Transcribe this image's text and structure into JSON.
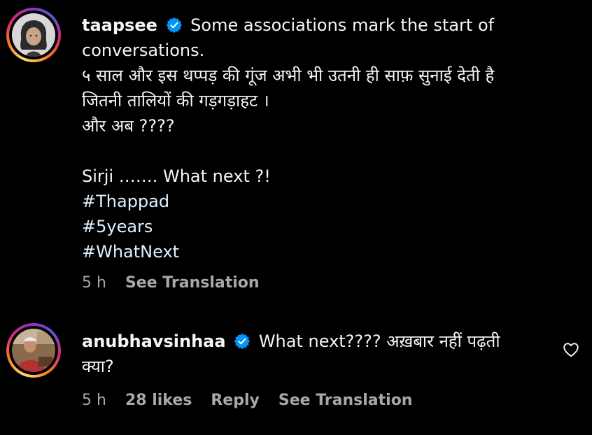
{
  "comments": [
    {
      "username": "taapsee",
      "text_first": "Some associations mark the start of",
      "text_lines": [
        "conversations.",
        "५ साल और इस थप्पड़ की गूंज अभी भी उतनी ही साफ़ सुनाई देती है",
        "जितनी तालियों की गड़गड़ाहट ।",
        "और अब ????",
        "",
        "Sirji ……. What next ?!"
      ],
      "hashtags": [
        "#Thappad",
        "#5years",
        "#WhatNext"
      ],
      "time": "5 h",
      "see_translation": "See Translation"
    },
    {
      "username": "anubhavsinhaa",
      "text_first": "What next???? अख़बार नहीं पढ़ती",
      "text_lines": [
        "क्या?"
      ],
      "time": "5 h",
      "likes": "28 likes",
      "reply": "Reply",
      "see_translation": "See Translation"
    }
  ],
  "colors": {
    "background": "#000000",
    "text": "#f5f5f5",
    "meta": "#a8a8a8",
    "verified": "#0095f6",
    "hashtag": "#e0f1ff"
  },
  "icons": {
    "verified": "verified-badge-icon",
    "like": "heart-outline-icon"
  }
}
